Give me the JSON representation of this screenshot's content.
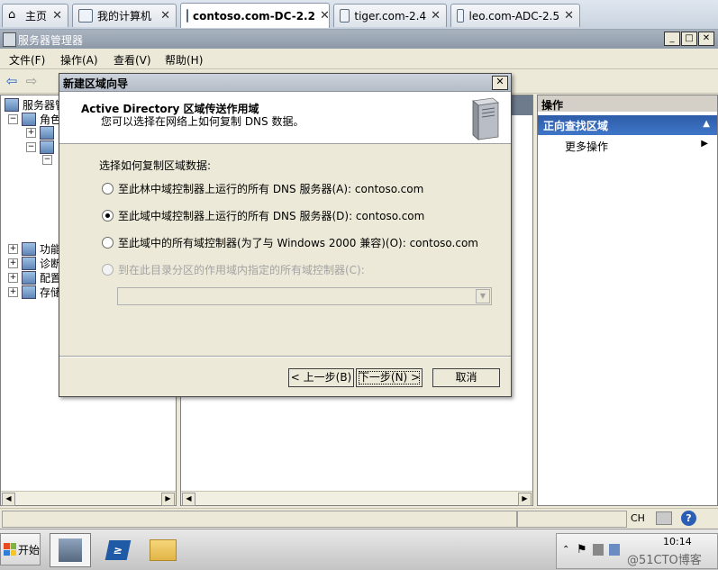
{
  "tabs": [
    {
      "label": "主页",
      "icon": "home-icon"
    },
    {
      "label": "我的计算机",
      "icon": "computer-icon"
    },
    {
      "label": "contoso.com-DC-2.2",
      "icon": "vm-icon"
    },
    {
      "label": "tiger.com-2.4",
      "icon": "vm-icon"
    },
    {
      "label": "leo.com-ADC-2.5",
      "icon": "vm-icon"
    }
  ],
  "window": {
    "title": "服务器管理器"
  },
  "menu": {
    "file": "文件(F)",
    "action": "操作(A)",
    "view": "查看(V)",
    "help": "帮助(H)"
  },
  "tree": {
    "root": "服务器管",
    "roles": "角色",
    "features": "功能",
    "diagnostics": "诊断",
    "config": "配置",
    "storage": "存储"
  },
  "actions": {
    "header": "操作",
    "section": "正向查找区域",
    "more": "更多操作"
  },
  "dialog": {
    "title": "新建区域向导",
    "heading": "Active Directory 区域传送作用域",
    "subheading": "您可以选择在网络上如何复制 DNS 数据。",
    "prompt": "选择如何复制区域数据:",
    "options": [
      {
        "label": "至此林中域控制器上运行的所有 DNS 服务器(A): contoso.com",
        "selected": false,
        "enabled": true
      },
      {
        "label": "至此域中域控制器上运行的所有 DNS 服务器(D): contoso.com",
        "selected": true,
        "enabled": true
      },
      {
        "label": "至此域中的所有域控制器(为了与 Windows 2000 兼容)(O): contoso.com",
        "selected": false,
        "enabled": true
      },
      {
        "label": "到在此目录分区的作用域内指定的所有域控制器(C):",
        "selected": false,
        "enabled": false
      }
    ],
    "back": "< 上一步(B)",
    "next": "下一步(N) >",
    "cancel": "取消"
  },
  "statusbar": {
    "ime": "CH"
  },
  "taskbar": {
    "start": "开始",
    "time": "10:14",
    "watermark": "@51CTO博客"
  }
}
